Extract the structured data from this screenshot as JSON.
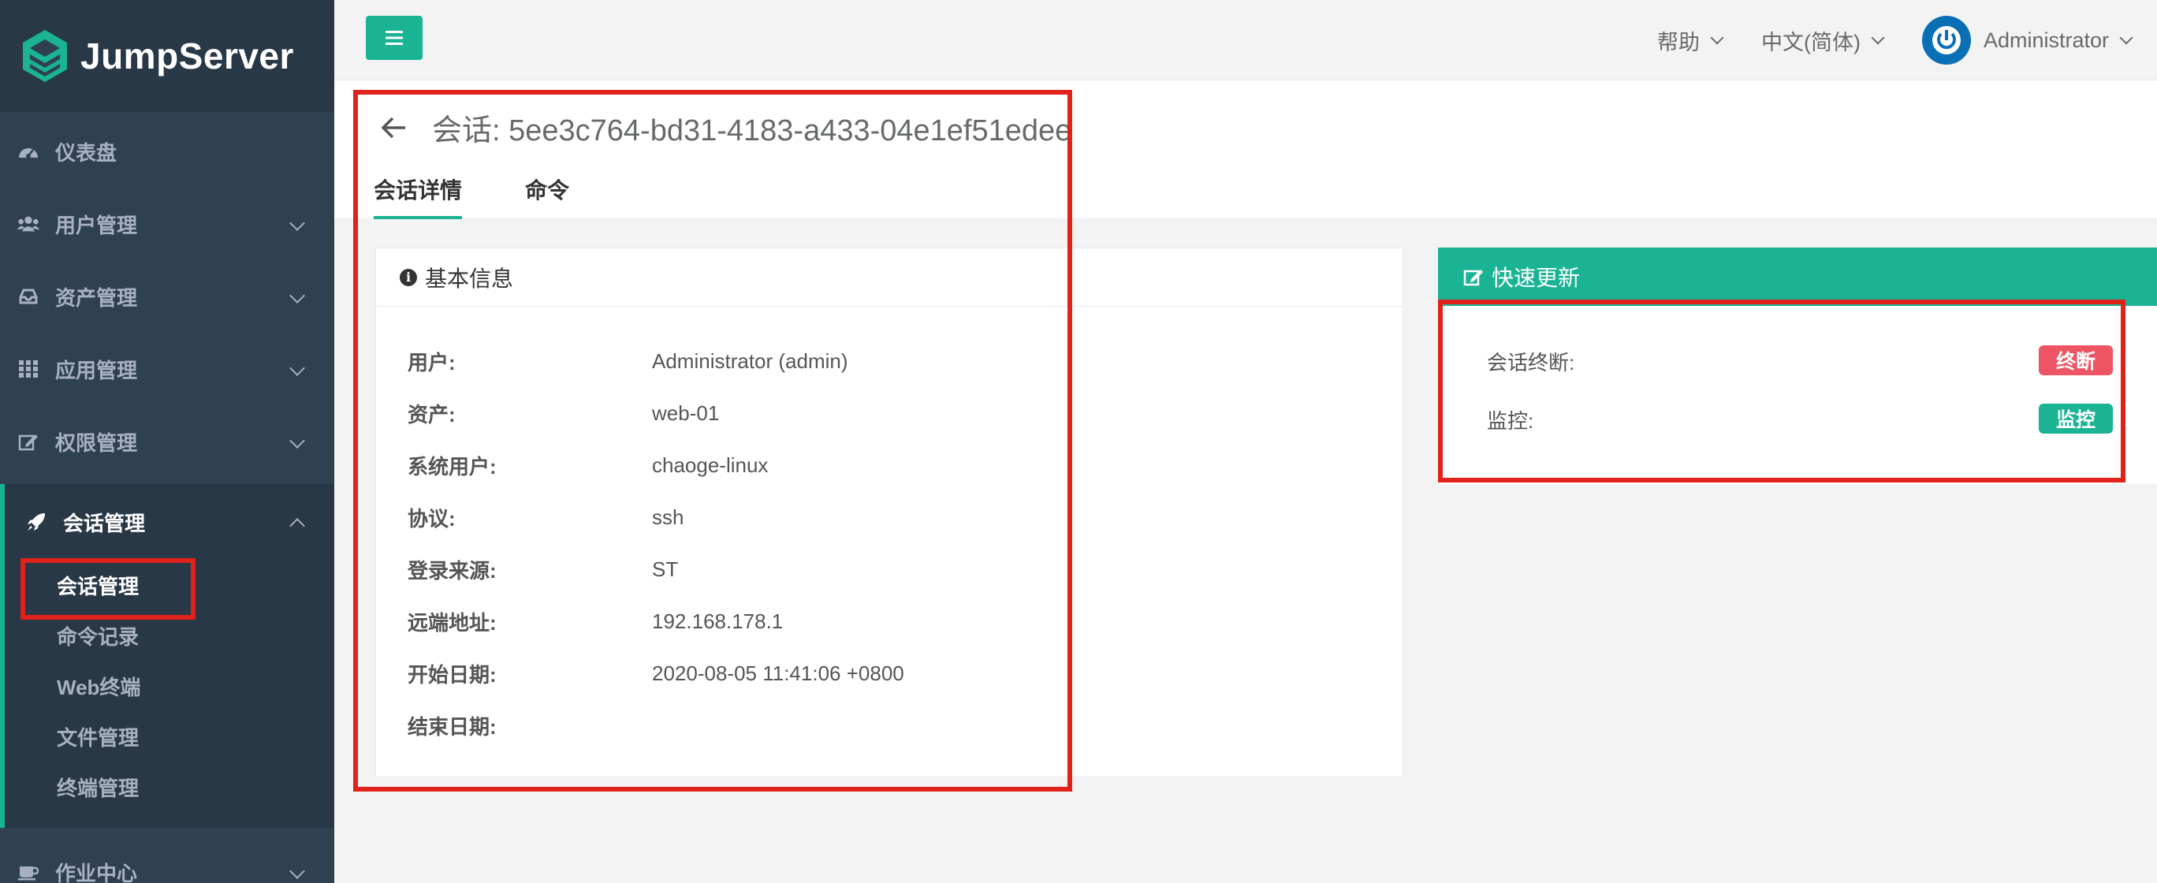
{
  "app": {
    "name": "JumpServer"
  },
  "sidebar": {
    "items": [
      {
        "label": "仪表盘",
        "icon": "dashboard-icon",
        "has_children": false
      },
      {
        "label": "用户管理",
        "icon": "users-icon",
        "has_children": true
      },
      {
        "label": "资产管理",
        "icon": "inbox-icon",
        "has_children": true
      },
      {
        "label": "应用管理",
        "icon": "grid-icon",
        "has_children": true
      },
      {
        "label": "权限管理",
        "icon": "edit-icon",
        "has_children": true
      }
    ],
    "open_group": {
      "label": "会话管理",
      "icon": "rocket-icon",
      "children": [
        {
          "label": "会话管理",
          "active": true
        },
        {
          "label": "命令记录",
          "active": false
        },
        {
          "label": "Web终端",
          "active": false
        },
        {
          "label": "文件管理",
          "active": false
        },
        {
          "label": "终端管理",
          "active": false
        }
      ]
    },
    "bottom_item": {
      "label": "作业中心",
      "icon": "coffee-icon",
      "has_children": true
    }
  },
  "topbar": {
    "help": "帮助",
    "language": "中文(简体)",
    "user": "Administrator"
  },
  "page": {
    "title": "会话: 5ee3c764-bd31-4183-a433-04e1ef51edee",
    "tabs": [
      {
        "label": "会话详情",
        "active": true
      },
      {
        "label": "命令",
        "active": false
      }
    ]
  },
  "basic_info": {
    "title": "基本信息",
    "rows": [
      {
        "label": "用户:",
        "value": "Administrator (admin)"
      },
      {
        "label": "资产:",
        "value": "web-01"
      },
      {
        "label": "系统用户:",
        "value": "chaoge-linux"
      },
      {
        "label": "协议:",
        "value": "ssh"
      },
      {
        "label": "登录来源:",
        "value": "ST"
      },
      {
        "label": "远端地址:",
        "value": "192.168.178.1"
      },
      {
        "label": "开始日期:",
        "value": "2020-08-05 11:41:06 +0800"
      },
      {
        "label": "结束日期:",
        "value": ""
      }
    ]
  },
  "quick_update": {
    "title": "快速更新",
    "terminate_label": "会话终断:",
    "terminate_button": "终断",
    "monitor_label": "监控:",
    "monitor_button": "监控"
  },
  "colors": {
    "sidebar_bg": "#2f4050",
    "accent": "#1ab394",
    "danger": "#ed5565",
    "highlight": "#e0221a"
  }
}
